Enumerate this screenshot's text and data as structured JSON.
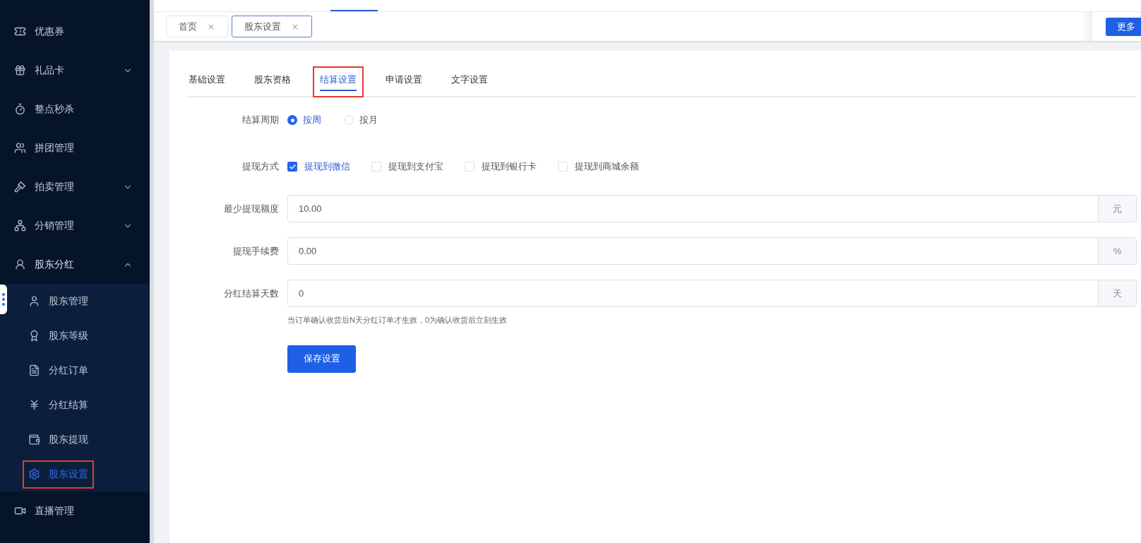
{
  "sidebar": {
    "items": [
      {
        "label": "优惠券"
      },
      {
        "label": "礼品卡",
        "expanded": false
      },
      {
        "label": "整点秒杀"
      },
      {
        "label": "拼团管理"
      },
      {
        "label": "拍卖管理",
        "expanded": false
      },
      {
        "label": "分销管理",
        "expanded": false
      },
      {
        "label": "股东分红",
        "expanded": true,
        "children": [
          {
            "label": "股东管理",
            "selected": false,
            "highlighted": false
          },
          {
            "label": "股东等级",
            "selected": false,
            "highlighted": false
          },
          {
            "label": "分红订单",
            "selected": false,
            "highlighted": false
          },
          {
            "label": "分红结算",
            "selected": false,
            "highlighted": false
          },
          {
            "label": "股东提现",
            "selected": false,
            "highlighted": false
          },
          {
            "label": "股东设置",
            "selected": true,
            "highlighted": true
          }
        ]
      },
      {
        "label": "直播管理"
      }
    ]
  },
  "page_tabs": [
    {
      "label": "首页",
      "selected": false
    },
    {
      "label": "股东设置",
      "selected": true
    }
  ],
  "more_button": "更多",
  "settings_tabs": [
    {
      "label": "基础设置",
      "selected": false,
      "highlighted": false
    },
    {
      "label": "股东资格",
      "selected": false,
      "highlighted": false
    },
    {
      "label": "结算设置",
      "selected": true,
      "highlighted": true
    },
    {
      "label": "申请设置",
      "selected": false,
      "highlighted": false
    },
    {
      "label": "文字设置",
      "selected": false,
      "highlighted": false
    }
  ],
  "form": [
    {
      "kind": "radio",
      "label": "结算周期",
      "options": [
        {
          "label": "按周",
          "selected": true
        },
        {
          "label": "按月",
          "selected": false
        }
      ]
    },
    {
      "kind": "checkbox",
      "label": "提现方式",
      "options": [
        {
          "label": "提现到微信",
          "checked": true
        },
        {
          "label": "提现到支付宝",
          "checked": false
        },
        {
          "label": "提现到银行卡",
          "checked": false
        },
        {
          "label": "提现到商城余额",
          "checked": false
        }
      ]
    },
    {
      "kind": "input",
      "label": "最少提现额度",
      "value": "10.00",
      "suffix": "元"
    },
    {
      "kind": "input",
      "label": "提现手续费",
      "value": "0.00",
      "suffix": "%"
    },
    {
      "kind": "input",
      "label": "分红结算天数",
      "value": "0",
      "suffix": "天",
      "hint": "当订单确认收货后N天分红订单才生效，0为确认收货后立刻生效"
    }
  ],
  "save_button": "保存设置"
}
